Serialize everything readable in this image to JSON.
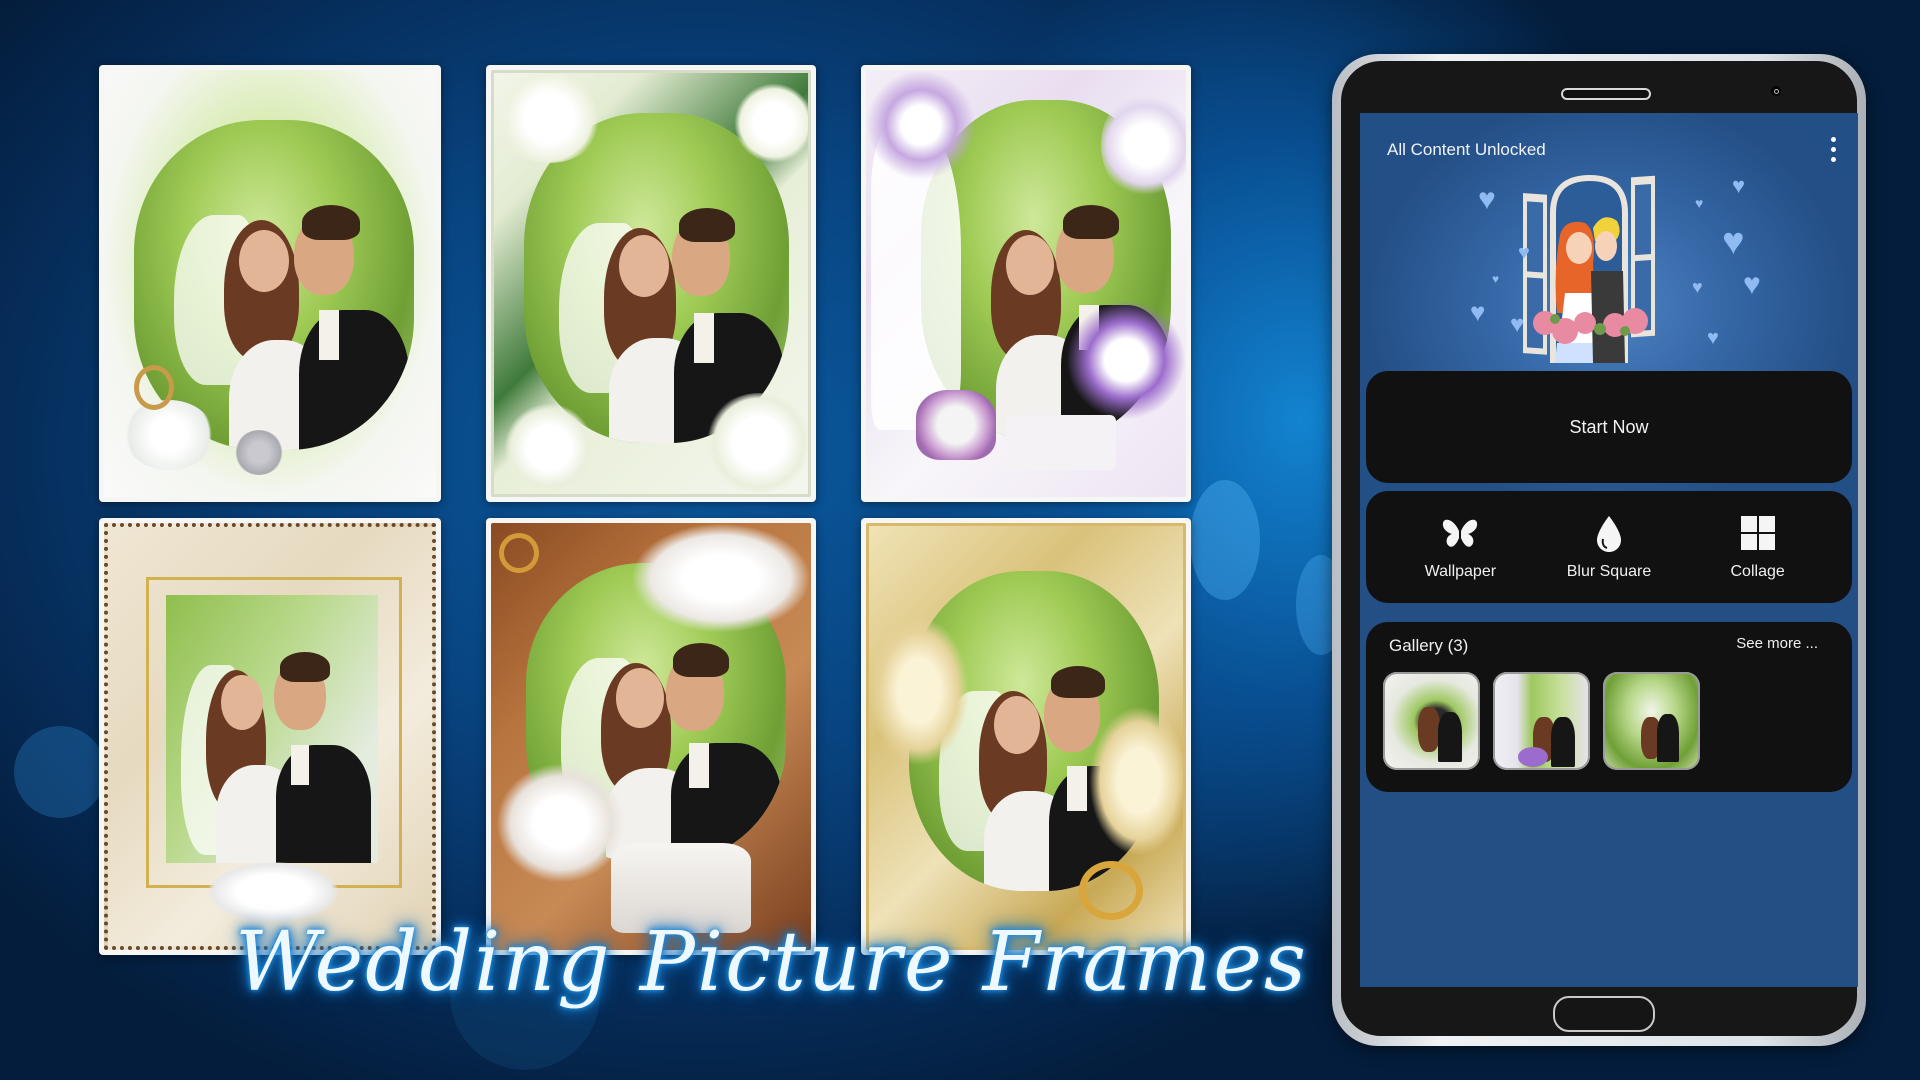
{
  "promo_title": "Wedding Picture Frames",
  "frames": [
    {
      "name": "white-diamond-frame",
      "theme": "white flowers and diamonds"
    },
    {
      "name": "white-jasmine-frame",
      "theme": "white jasmine on green"
    },
    {
      "name": "lilac-orchid-frame",
      "theme": "white and purple orchids with ring box"
    },
    {
      "name": "cream-gold-doves-frame",
      "theme": "cream and gold with doves"
    },
    {
      "name": "bronze-lily-frame",
      "theme": "bronze with white lilies and cake"
    },
    {
      "name": "golden-lily-frame",
      "theme": "golden lilies with rings"
    }
  ],
  "app": {
    "header_title": "All Content Unlocked",
    "menu_icon": "more-vertical-icon",
    "start_button": "Start Now",
    "tools": [
      {
        "label": "Wallpaper",
        "icon": "butterfly-icon"
      },
      {
        "label": "Blur Square",
        "icon": "drop-icon"
      },
      {
        "label": "Collage",
        "icon": "grid-icon"
      }
    ],
    "gallery": {
      "title": "Gallery (3)",
      "see_more": "See more ...",
      "thumbnails": [
        "gallery-photo-1",
        "gallery-photo-2",
        "gallery-photo-3"
      ]
    }
  },
  "colors": {
    "background": "#08437f",
    "screen_blue": "#234f85",
    "card_black": "#111112",
    "title_glow": "#1f8fe0",
    "heart": "#8fbaf2"
  }
}
